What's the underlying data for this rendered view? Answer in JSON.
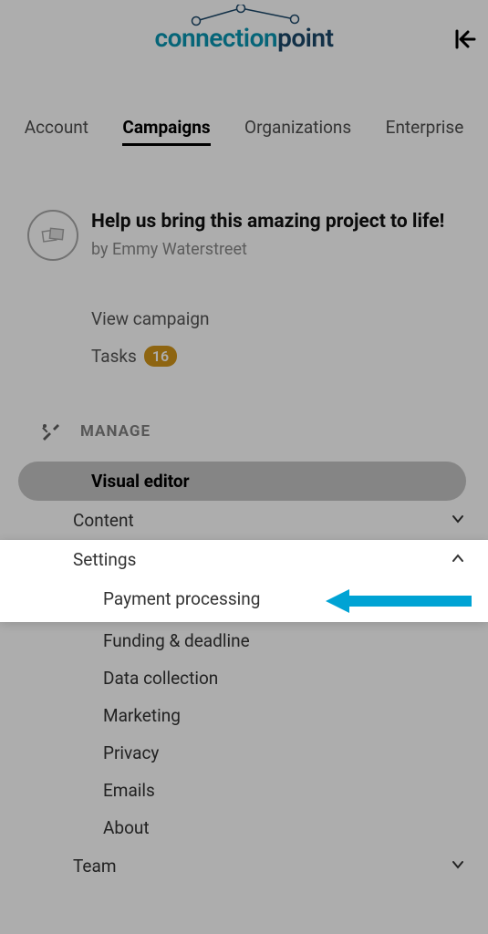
{
  "logo": {
    "part1": "connection",
    "part2": "point"
  },
  "nav": {
    "tabs": [
      {
        "label": "Account",
        "active": false
      },
      {
        "label": "Campaigns",
        "active": true
      },
      {
        "label": "Organizations",
        "active": false
      },
      {
        "label": "Enterprise",
        "active": false
      }
    ]
  },
  "campaign": {
    "title": "Help us bring this amazing project to life!",
    "author_prefix": "by ",
    "author": "Emmy Waterstreet",
    "view_label": "View campaign",
    "tasks_label": "Tasks",
    "tasks_count": "16"
  },
  "manage": {
    "section_label": "MANAGE",
    "items": {
      "visual_editor": "Visual editor",
      "content": "Content",
      "settings": "Settings",
      "team": "Team"
    },
    "settings_sub": [
      "Payment processing",
      "Funding & deadline",
      "Data collection",
      "Marketing",
      "Privacy",
      "Emails",
      "About"
    ]
  },
  "colors": {
    "accent": "#00a3d4",
    "badge": "#d2951a",
    "logo1": "#0a95b1",
    "logo2": "#1b4769"
  }
}
